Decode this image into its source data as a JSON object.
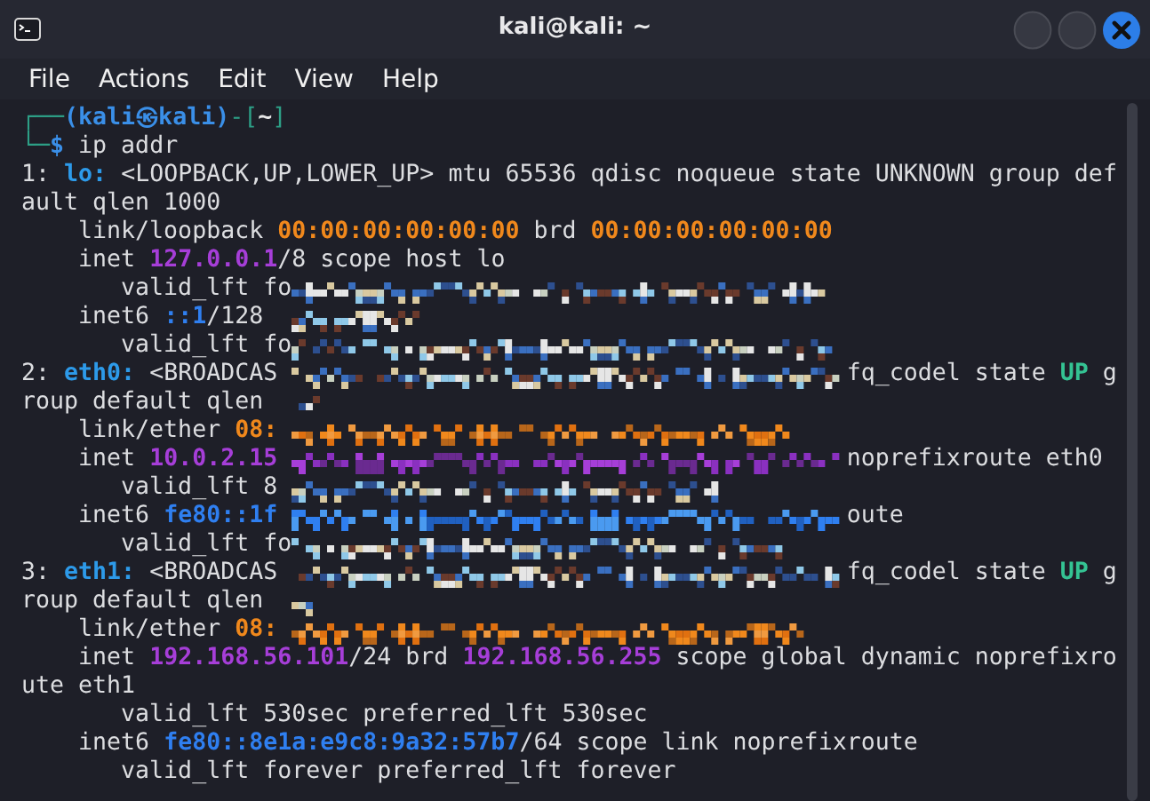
{
  "window": {
    "title": "kali@kali: ~"
  },
  "menu": [
    "File",
    "Actions",
    "Edit",
    "View",
    "Help"
  ],
  "terminal": {
    "lines": [
      {
        "segments": [
          {
            "text": "┌──",
            "kind": "frame"
          },
          {
            "text": "(kali㉿kali)",
            "kind": "user"
          },
          {
            "text": "-[",
            "kind": "frame"
          },
          {
            "text": "~",
            "kind": "dir"
          },
          {
            "text": "]",
            "kind": "frame"
          }
        ]
      },
      {
        "segments": [
          {
            "text": "└─",
            "kind": "frame"
          },
          {
            "text": "$",
            "kind": "user"
          },
          {
            "text": " ip addr",
            "kind": "plain"
          }
        ]
      },
      {
        "segments": [
          {
            "text": "1: ",
            "kind": "plain"
          },
          {
            "text": "lo:",
            "kind": "iface"
          },
          {
            "text": " <LOOPBACK,UP,LOWER_UP> mtu 65536 qdisc noqueue state UNKNOWN group def",
            "kind": "plain"
          }
        ]
      },
      {
        "segments": [
          {
            "text": "ault qlen 1000",
            "kind": "plain"
          }
        ]
      },
      {
        "segments": [
          {
            "text": "    link/loopback ",
            "kind": "plain"
          },
          {
            "text": "00:00:00:00:00:00",
            "kind": "mac"
          },
          {
            "text": " brd ",
            "kind": "plain"
          },
          {
            "text": "00:00:00:00:00:00",
            "kind": "mac"
          }
        ]
      },
      {
        "segments": [
          {
            "text": "    inet ",
            "kind": "plain"
          },
          {
            "text": "127.0.0.1",
            "kind": "ipv4"
          },
          {
            "text": "/8 scope host lo",
            "kind": "plain"
          }
        ]
      },
      {
        "segments": [
          {
            "text": "       valid_lft fo",
            "kind": "plain"
          }
        ]
      },
      {
        "segments": [
          {
            "text": "    inet6 ",
            "kind": "plain"
          },
          {
            "text": "::1",
            "kind": "ipv6"
          },
          {
            "text": "/128",
            "kind": "plain"
          }
        ]
      },
      {
        "segments": [
          {
            "text": "       valid_lft fo",
            "kind": "plain"
          }
        ]
      },
      {
        "segments": [
          {
            "text": "2: ",
            "kind": "plain"
          },
          {
            "text": "eth0:",
            "kind": "iface"
          },
          {
            "text": " <BROADCAS",
            "kind": "plain"
          }
        ],
        "right": [
          {
            "text": "fq_codel state ",
            "kind": "plain"
          },
          {
            "text": "UP",
            "kind": "state"
          },
          {
            "text": " g",
            "kind": "plain"
          }
        ]
      },
      {
        "segments": [
          {
            "text": "roup default qlen",
            "kind": "plain"
          }
        ]
      },
      {
        "segments": [
          {
            "text": "    link/ether ",
            "kind": "plain"
          },
          {
            "text": "08:",
            "kind": "mac"
          }
        ]
      },
      {
        "segments": [
          {
            "text": "    inet ",
            "kind": "plain"
          },
          {
            "text": "10.0.2.15",
            "kind": "ipv4"
          }
        ],
        "right": [
          {
            "text": "noprefixroute eth0",
            "kind": "plain"
          }
        ]
      },
      {
        "segments": [
          {
            "text": "       valid_lft 8",
            "kind": "plain"
          }
        ]
      },
      {
        "segments": [
          {
            "text": "    inet6 ",
            "kind": "plain"
          },
          {
            "text": "fe80::1f",
            "kind": "ipv6"
          }
        ],
        "right": [
          {
            "text": "oute",
            "kind": "plain"
          }
        ]
      },
      {
        "segments": [
          {
            "text": "       valid_lft fo",
            "kind": "plain"
          }
        ]
      },
      {
        "segments": [
          {
            "text": "3: ",
            "kind": "plain"
          },
          {
            "text": "eth1:",
            "kind": "iface"
          },
          {
            "text": " <BROADCAS",
            "kind": "plain"
          }
        ],
        "right": [
          {
            "text": "fq_codel state ",
            "kind": "plain"
          },
          {
            "text": "UP",
            "kind": "state"
          },
          {
            "text": " g",
            "kind": "plain"
          }
        ]
      },
      {
        "segments": [
          {
            "text": "roup default qlen",
            "kind": "plain"
          }
        ]
      },
      {
        "segments": [
          {
            "text": "    link/ether ",
            "kind": "plain"
          },
          {
            "text": "08:",
            "kind": "mac"
          }
        ]
      },
      {
        "segments": [
          {
            "text": "    inet ",
            "kind": "plain"
          },
          {
            "text": "192.168.56.101",
            "kind": "ipv4"
          },
          {
            "text": "/24 brd ",
            "kind": "plain"
          },
          {
            "text": "192.168.56.255",
            "kind": "ipv4"
          },
          {
            "text": " scope global dynamic noprefixro",
            "kind": "plain"
          }
        ]
      },
      {
        "segments": [
          {
            "text": "ute eth1",
            "kind": "plain"
          }
        ]
      },
      {
        "segments": [
          {
            "text": "       valid_lft 530sec preferred_lft 530sec",
            "kind": "plain"
          }
        ]
      },
      {
        "segments": [
          {
            "text": "    inet6 ",
            "kind": "plain"
          },
          {
            "text": "fe80::8e1a:e9c8:9a32:57b7",
            "kind": "ipv6"
          },
          {
            "text": "/64 scope link noprefixroute",
            "kind": "plain"
          }
        ]
      },
      {
        "segments": [
          {
            "text": "       valid_lft forever preferred_lft forever",
            "kind": "plain"
          }
        ]
      }
    ]
  }
}
